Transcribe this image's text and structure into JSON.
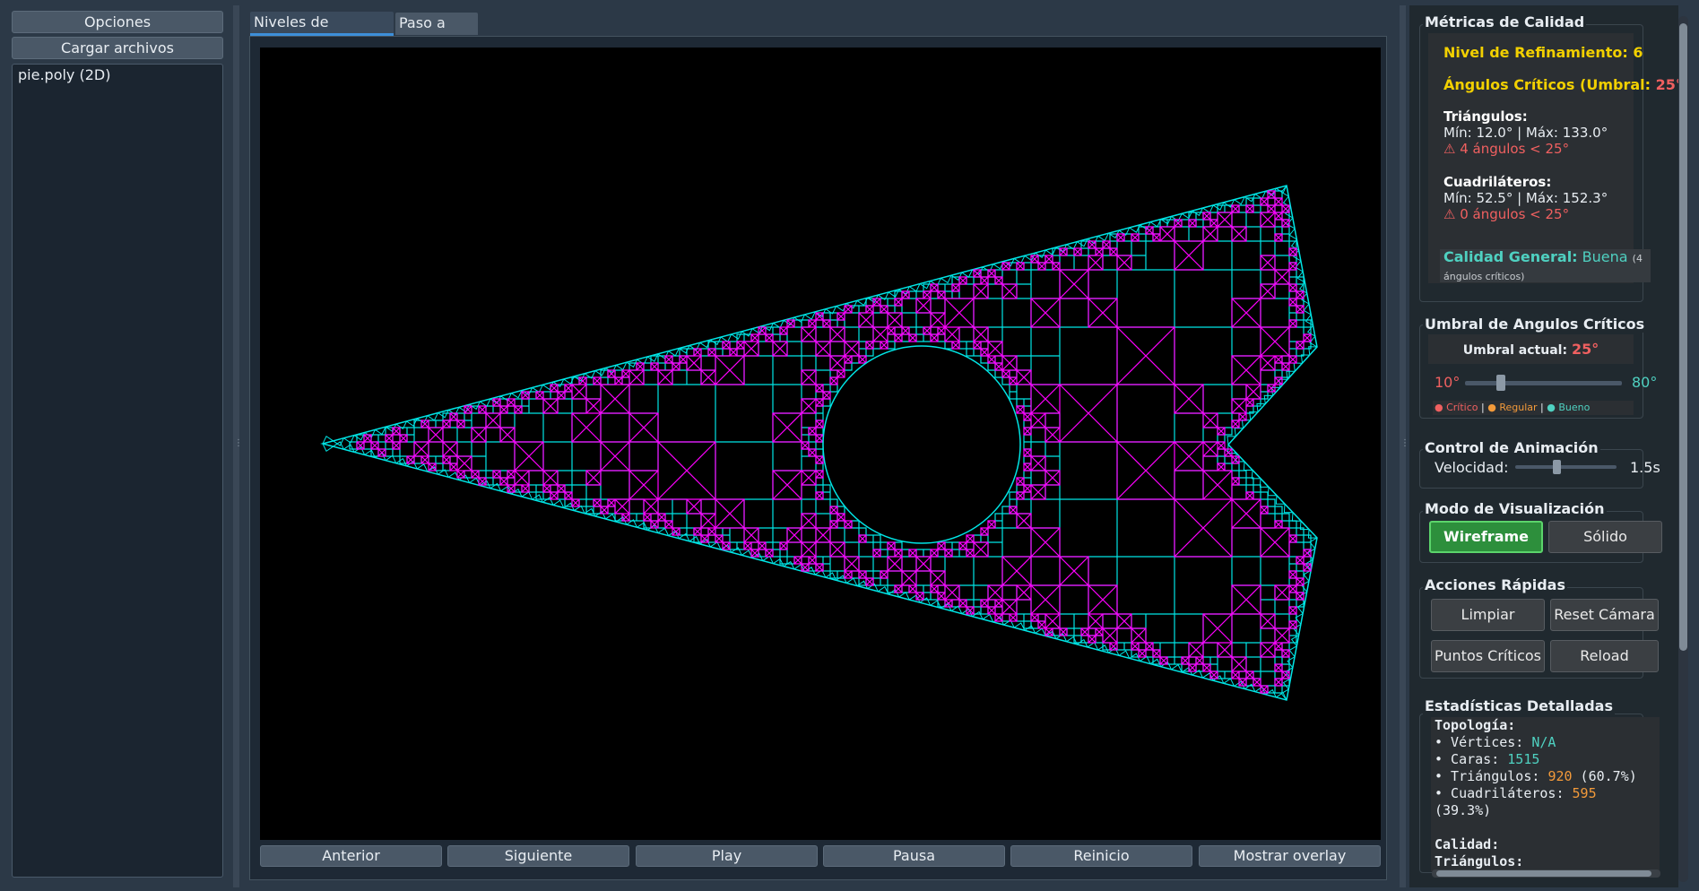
{
  "left": {
    "options_label": "Opciones",
    "load_label": "Cargar archivos",
    "files": [
      "pie.poly (2D)"
    ]
  },
  "tabs": [
    {
      "label": "Niveles de refinación",
      "active": true
    },
    {
      "label": "Paso a paso",
      "active": false
    }
  ],
  "mesh": {
    "colors": {
      "quads": "#00e5e5",
      "triangles": "#ff00ff"
    }
  },
  "controls": [
    "Anterior",
    "Siguiente",
    "Play",
    "Pausa",
    "Reinicio",
    "Mostrar overlay"
  ],
  "metrics": {
    "title": "Métricas de Calidad",
    "level": "Nivel de Refinamiento: 6",
    "critical_prefix": "Ángulos Críticos (Umbral: ",
    "critical_value": "25°",
    "critical_suffix": ")",
    "tri_title": "Triángulos:",
    "tri_range": "Mín: 12.0° | Máx: 133.0°",
    "tri_warning": "⚠ 4 ángulos < 25°",
    "quad_title": "Cuadriláteros:",
    "quad_range": "Mín: 52.5° | Máx: 152.3°",
    "quad_warning": "⚠ 0 ángulos < 25°",
    "general_label": "Calidad General:",
    "general_value": "Buena",
    "general_note": "(4 ángulos críticos)"
  },
  "threshold": {
    "title": "Umbral de Angulos Críticos",
    "current_label": "Umbral actual:",
    "current_value": "25°",
    "min": "10°",
    "max": "80°",
    "slider_fraction": 0.214,
    "legend_critical": "● Crítico",
    "legend_regular": "● Regular",
    "legend_good": "● Bueno",
    "sep": "|"
  },
  "animation": {
    "title": "Control de Animación",
    "speed_label": "Velocidad:",
    "speed_value": "1.5s",
    "slider_fraction": 0.4
  },
  "view_mode": {
    "title": "Modo de Visualización",
    "wireframe": "Wireframe",
    "solid": "Sólido"
  },
  "quick": {
    "title": "Acciones Rápidas",
    "clear": "Limpiar",
    "reset_camera": "Reset Cámara",
    "critical_points": "Puntos Críticos",
    "reload": "Reload"
  },
  "stats": {
    "title": "Estadísticas Detalladas",
    "topology_title": "Topología:",
    "vertices_label": "• Vértices: ",
    "vertices_value": "N/A",
    "faces_label": "• Caras: ",
    "faces_value": "1515",
    "tri_label": "• Triángulos: ",
    "tri_value": "920",
    "tri_pct": " (60.7%)",
    "quad_label": "• Cuadriláteros: ",
    "quad_value": "595",
    "quad_pct": "(39.3%)",
    "quality_title": "Calidad:",
    "quality_tri_title": "Triángulos:"
  }
}
